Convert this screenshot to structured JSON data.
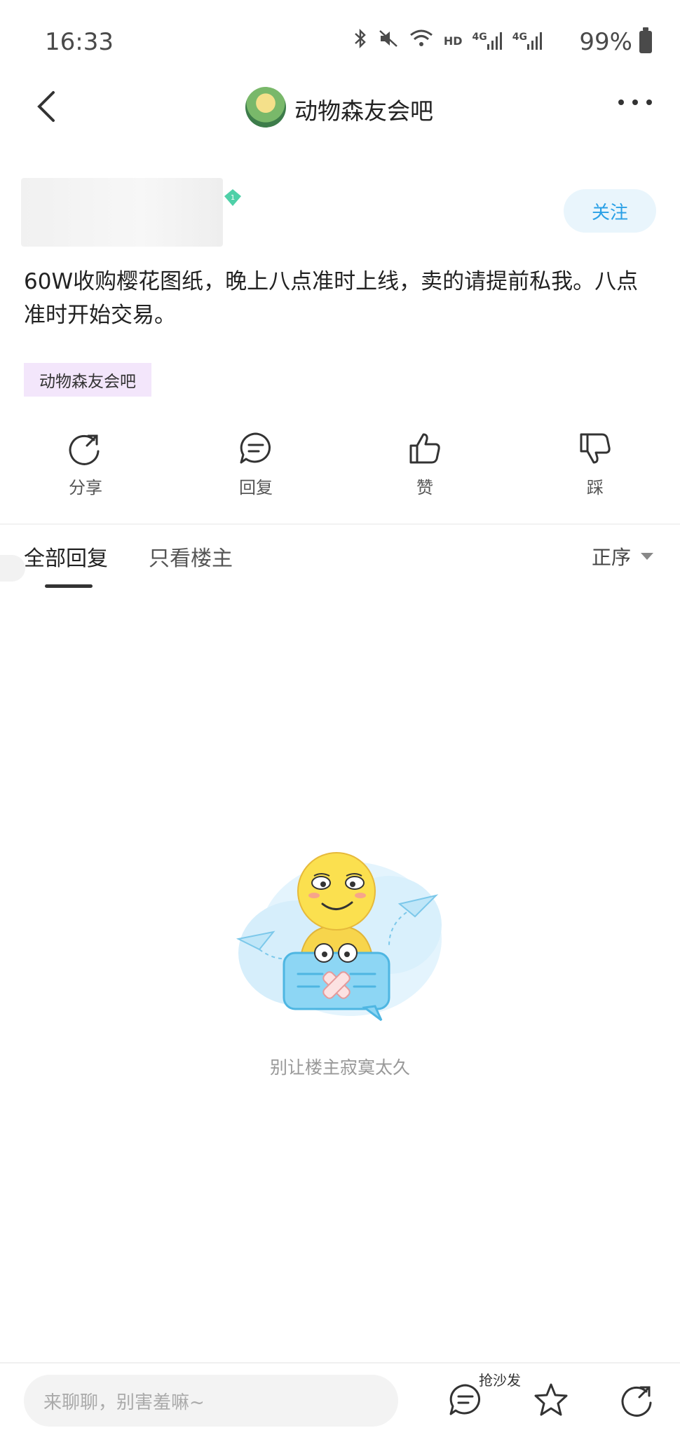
{
  "status_bar": {
    "time": "16:33",
    "network_label": "HD",
    "signal_1": "4G",
    "signal_2": "4G",
    "battery": "99%"
  },
  "header": {
    "forum_name": "动物森友会吧",
    "avatar_icon": "forum-avatar-icon",
    "back_icon": "chevron-left-icon",
    "more_icon": "more-dots-icon"
  },
  "post": {
    "follow_label": "关注",
    "level_badge": "1",
    "text": "60W收购樱花图纸，晚上八点准时上线，卖的请提前私我。八点准时开始交易。",
    "tag": "动物森友会吧"
  },
  "actions": [
    {
      "label": "分享",
      "icon": "share-icon"
    },
    {
      "label": "回复",
      "icon": "comment-icon"
    },
    {
      "label": "赞",
      "icon": "thumbs-up-icon"
    },
    {
      "label": "踩",
      "icon": "thumbs-down-icon"
    }
  ],
  "tabs": {
    "all_replies": "全部回复",
    "owner_only": "只看楼主",
    "sort": "正序"
  },
  "empty_state": {
    "text": "别让楼主寂寞太久"
  },
  "bottom_bar": {
    "input_placeholder": "来聊聊，别害羞嘛~",
    "sofa_label": "抢沙发",
    "icons": [
      "comment-icon",
      "star-icon",
      "share-icon"
    ]
  },
  "colors": {
    "accent": "#2aa0e6",
    "follow_bg": "#e9f5fc",
    "tag_bg": "#f3e6fb"
  }
}
